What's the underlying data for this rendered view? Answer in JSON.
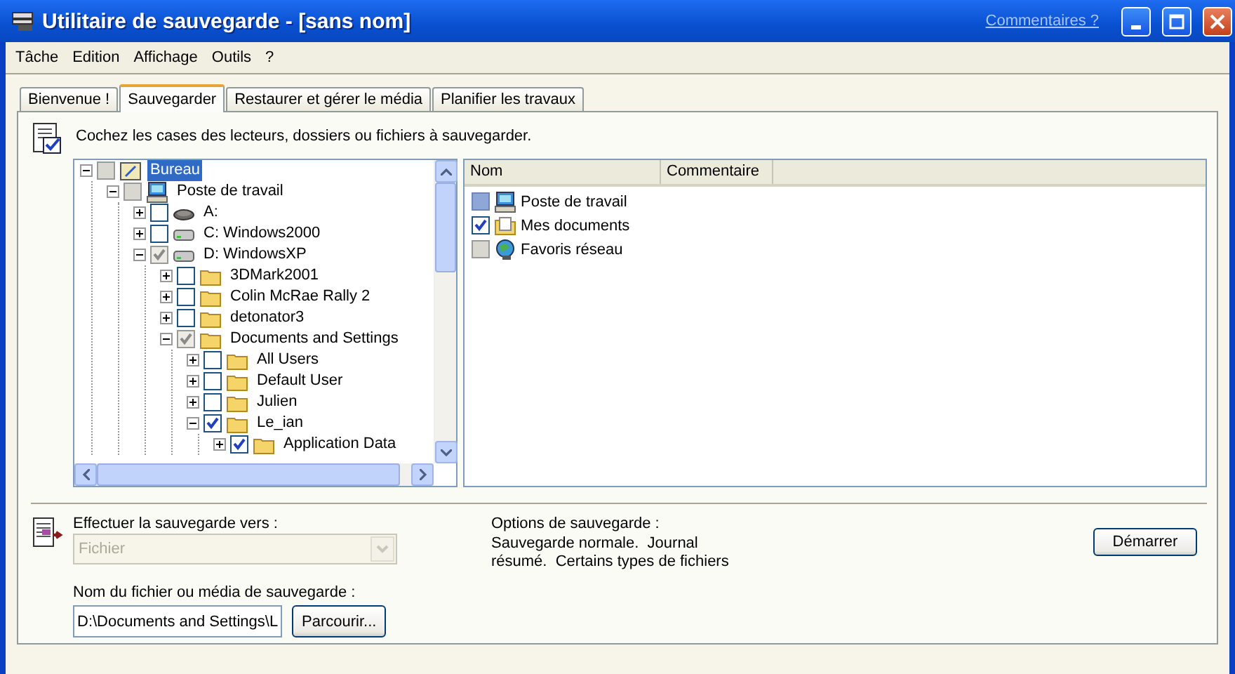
{
  "window": {
    "title": "Utilitaire de sauvegarde - [sans nom]",
    "help_link": "Commentaires ?"
  },
  "menu": [
    "Tâche",
    "Edition",
    "Affichage",
    "Outils",
    "?"
  ],
  "tabs": [
    {
      "label": "Bienvenue !",
      "selected": false
    },
    {
      "label": "Sauvegarder",
      "selected": true
    },
    {
      "label": "Restaurer et gérer le média",
      "selected": false
    },
    {
      "label": "Planifier les travaux",
      "selected": false
    }
  ],
  "instruction": "Cochez les cases des lecteurs, dossiers ou fichiers à sauvegarder.",
  "tree": [
    {
      "label": "Bureau",
      "kind": "desktop",
      "checked": false,
      "partial": true,
      "dimmed": true,
      "expanded": true,
      "selected": true,
      "children": [
        {
          "label": "Poste de travail",
          "kind": "computer",
          "checked": false,
          "partial": true,
          "dimmed": true,
          "expanded": true,
          "selected": false,
          "children": [
            {
              "label": "A:",
              "kind": "floppy",
              "checked": false,
              "partial": false,
              "dimmed": false,
              "expanded": false,
              "selected": false
            },
            {
              "label": "C: Windows2000",
              "kind": "drive",
              "checked": false,
              "partial": false,
              "dimmed": false,
              "expanded": false,
              "selected": false
            },
            {
              "label": "D: WindowsXP",
              "kind": "drive",
              "checked": true,
              "partial": false,
              "dimmed": true,
              "expanded": true,
              "selected": false,
              "children": [
                {
                  "label": "3DMark2001",
                  "kind": "folder",
                  "checked": false,
                  "partial": false,
                  "dimmed": false,
                  "expanded": false,
                  "selected": false
                },
                {
                  "label": "Colin McRae Rally 2",
                  "kind": "folder",
                  "checked": false,
                  "partial": false,
                  "dimmed": false,
                  "expanded": false,
                  "selected": false
                },
                {
                  "label": "detonator3",
                  "kind": "folder",
                  "checked": false,
                  "partial": false,
                  "dimmed": false,
                  "expanded": false,
                  "selected": false
                },
                {
                  "label": "Documents and Settings",
                  "kind": "folder",
                  "checked": true,
                  "partial": false,
                  "dimmed": true,
                  "expanded": true,
                  "selected": false,
                  "children": [
                    {
                      "label": "All Users",
                      "kind": "folder",
                      "checked": false,
                      "partial": false,
                      "dimmed": false,
                      "expanded": false,
                      "selected": false
                    },
                    {
                      "label": "Default User",
                      "kind": "folder",
                      "checked": false,
                      "partial": false,
                      "dimmed": false,
                      "expanded": false,
                      "selected": false
                    },
                    {
                      "label": "Julien",
                      "kind": "folder",
                      "checked": false,
                      "partial": false,
                      "dimmed": false,
                      "expanded": false,
                      "selected": false
                    },
                    {
                      "label": "Le_ian",
                      "kind": "folder",
                      "checked": true,
                      "partial": false,
                      "dimmed": false,
                      "expanded": true,
                      "selected": false,
                      "children": [
                        {
                          "label": "Application Data",
                          "kind": "folder",
                          "checked": true,
                          "partial": false,
                          "dimmed": false,
                          "expanded": false,
                          "selected": false
                        }
                      ]
                    }
                  ]
                }
              ]
            }
          ]
        }
      ]
    }
  ],
  "list": {
    "columns": [
      "Nom",
      "Commentaire"
    ],
    "rows": [
      {
        "name": "Poste de travail",
        "kind": "computer",
        "checked": false,
        "partial": true,
        "dimmed": false
      },
      {
        "name": "Mes documents",
        "kind": "documents",
        "checked": true,
        "partial": false,
        "dimmed": false
      },
      {
        "name": "Favoris réseau",
        "kind": "network",
        "checked": false,
        "partial": true,
        "dimmed": true
      }
    ]
  },
  "destination": {
    "label": "Effectuer la sauvegarde vers :",
    "value": "Fichier",
    "disabled": true
  },
  "file_name": {
    "label": "Nom du fichier ou média de sauvegarde :",
    "value": "D:\\Documents and Settings\\L",
    "browse_button": "Parcourir..."
  },
  "options": {
    "title": "Options de sauvegarde :",
    "lines": [
      "Sauvegarde normale.  Journal",
      "résumé.  Certains types de fichiers"
    ]
  },
  "start_button": "Démarrer"
}
